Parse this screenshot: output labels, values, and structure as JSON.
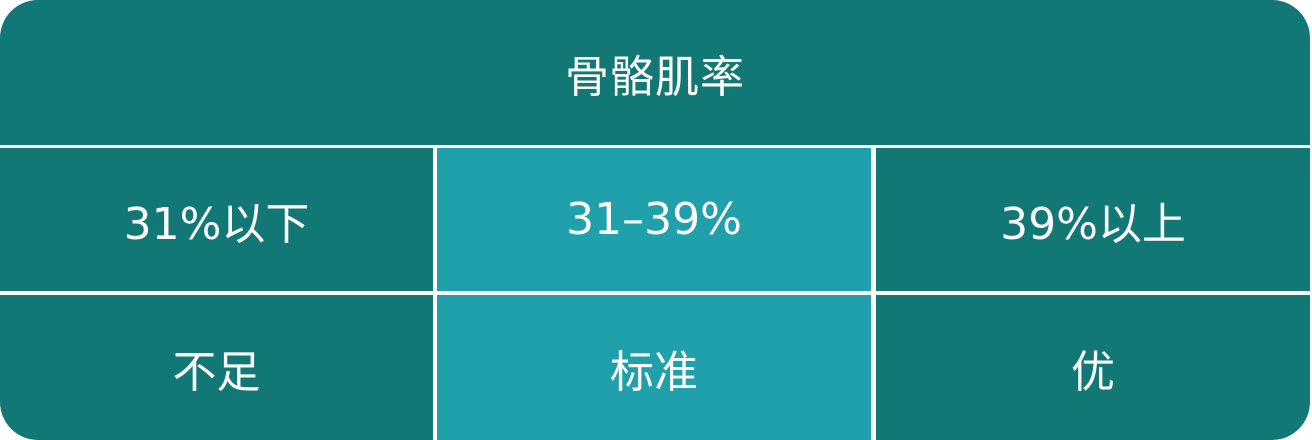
{
  "colors": {
    "header_bg": "#127876",
    "cell_bg": "#127876",
    "highlight_bg": "#1fa0aa",
    "divider": "#ffffff",
    "text": "#ffffff"
  },
  "title": "骨骼肌率",
  "ranges": [
    {
      "label": "31%以下",
      "highlighted": false
    },
    {
      "label": "31–39%",
      "highlighted": true
    },
    {
      "label": "39%以上",
      "highlighted": false
    }
  ],
  "ratings": [
    {
      "label": "不足",
      "highlighted": false
    },
    {
      "label": "标准",
      "highlighted": true
    },
    {
      "label": "优",
      "highlighted": false
    }
  ]
}
